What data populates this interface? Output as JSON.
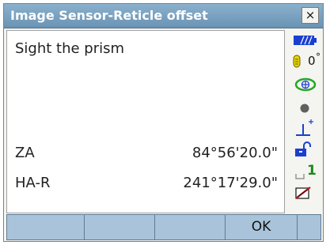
{
  "window": {
    "title": "Image Sensor-Reticle offset",
    "close_glyph": "×"
  },
  "content": {
    "message": "Sight the prism",
    "rows": [
      {
        "label": "ZA",
        "value": "84°56'20.0\""
      },
      {
        "label": "HA-R",
        "value": "241°17'29.0\""
      }
    ]
  },
  "status": {
    "tilt_value": "0",
    "port_value": "1",
    "icons": [
      "battery-icon",
      "tilt-icon",
      "target-icon",
      "prism-icon",
      "reflector-icon",
      "lock-icon",
      "port-icon",
      "input-mode-icon"
    ]
  },
  "softkeys": [
    "",
    "",
    "",
    "OK",
    ""
  ],
  "colors": {
    "titlebar": "#7aa3c2",
    "softkey": "#a9c4da",
    "battery": "#1a3fd0",
    "target": "#22a822"
  }
}
